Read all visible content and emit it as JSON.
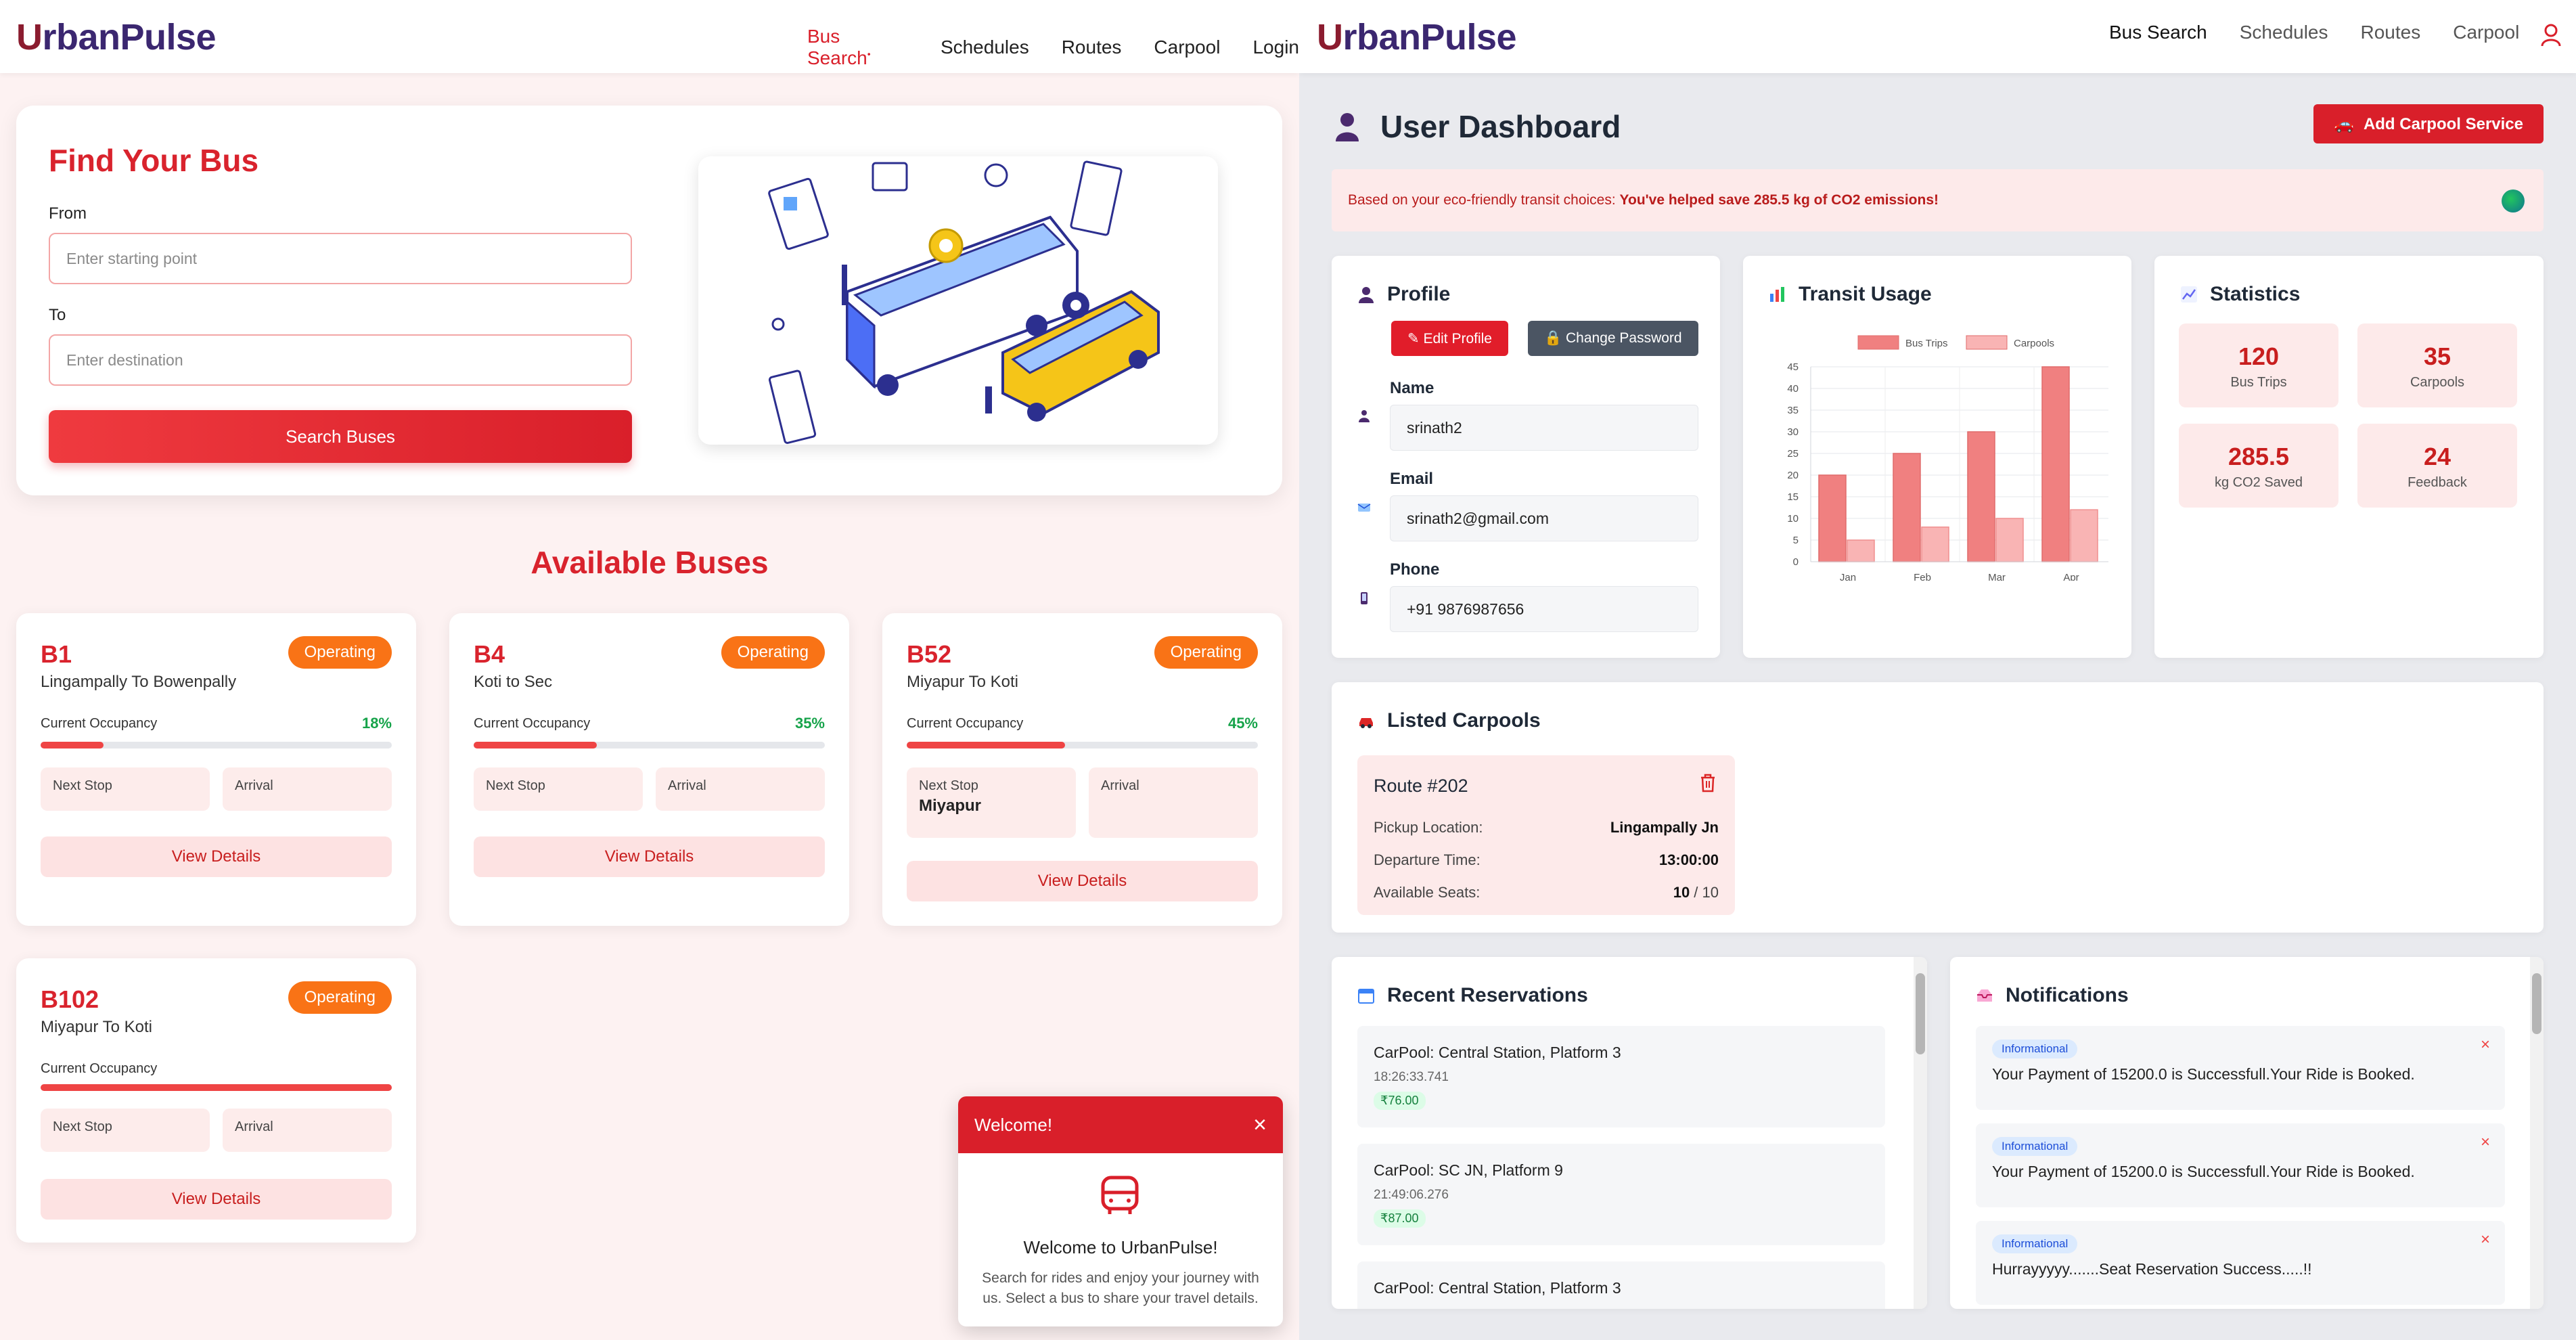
{
  "left": {
    "nav": {
      "logo_u": "U",
      "logo_rest": "rbanPulse",
      "links": [
        "Bus Search",
        "Schedules",
        "Routes",
        "Carpool",
        "Login"
      ]
    },
    "hero": {
      "title": "Find Your Bus",
      "from_label": "From",
      "from_placeholder": "Enter starting point",
      "to_label": "To",
      "to_placeholder": "Enter destination",
      "search_button": "Search Buses"
    },
    "available_title": "Available Buses",
    "buses": [
      {
        "number": "B1",
        "route": "Lingampally To Bowenpally",
        "status": "Operating",
        "occupancy_label": "Current Occupancy",
        "occupancy": "18%",
        "occupancy_fraction": 0.18,
        "next_stop_label": "Next Stop",
        "next_stop": "",
        "arrival_label": "Arrival",
        "button": "View Details"
      },
      {
        "number": "B4",
        "route": "Koti to Sec",
        "status": "Operating",
        "occupancy_label": "Current Occupancy",
        "occupancy": "35%",
        "occupancy_fraction": 0.35,
        "next_stop_label": "Next Stop",
        "next_stop": "",
        "arrival_label": "Arrival",
        "button": "View Details"
      },
      {
        "number": "B52",
        "route": "Miyapur To Koti",
        "status": "Operating",
        "occupancy_label": "Current Occupancy",
        "occupancy": "45%",
        "occupancy_fraction": 0.45,
        "next_stop_label": "Next Stop",
        "next_stop": "Miyapur",
        "arrival_label": "Arrival",
        "button": "View Details"
      },
      {
        "number": "B102",
        "route": "Miyapur To Koti",
        "status": "Operating",
        "occupancy_label": "Current Occupancy",
        "occupancy": "",
        "occupancy_fraction": 1.0,
        "next_stop_label": "Next Stop",
        "next_stop": "",
        "arrival_label": "Arrival",
        "button": "View Details"
      }
    ],
    "toast": {
      "header": "Welcome!",
      "close": "×",
      "title": "Welcome to UrbanPulse!",
      "body": "Search for rides and enjoy your journey with us. Select a bus to share your travel details."
    }
  },
  "right": {
    "nav": {
      "logo_u": "U",
      "logo_rest": "rbanPulse",
      "links": [
        "Bus Search",
        "Schedules",
        "Routes",
        "Carpool"
      ]
    },
    "title": "User Dashboard",
    "add_button": "Add Carpool Service",
    "eco_prefix": "Based on your eco-friendly transit choices:",
    "eco_bold": "You've helped save 285.5 kg of CO2 emissions!",
    "profile": {
      "title": "Profile",
      "edit_button": "Edit Profile",
      "password_button": "Change Password",
      "name_label": "Name",
      "name": "srinath2",
      "email_label": "Email",
      "email": "srinath2@gmail.com",
      "phone_label": "Phone",
      "phone": "+91 9876987656"
    },
    "transit": {
      "title": "Transit Usage"
    },
    "statistics": {
      "title": "Statistics",
      "items": [
        {
          "value": "120",
          "label": "Bus Trips"
        },
        {
          "value": "35",
          "label": "Carpools"
        },
        {
          "value": "285.5",
          "label": "kg CO2 Saved"
        },
        {
          "value": "24",
          "label": "Feedback"
        }
      ]
    },
    "carpools": {
      "title": "Listed Carpools",
      "route": "Route #202",
      "pickup_label": "Pickup Location:",
      "pickup": "Lingampally Jn",
      "departure_label": "Departure Time:",
      "departure": "13:00:00",
      "seats_label": "Available Seats:",
      "seats_avail": "10",
      "seats_total": " / 10"
    },
    "reservations": {
      "title": "Recent Reservations",
      "items": [
        {
          "title": "CarPool: Central Station, Platform 3",
          "time": "18:26:33.741",
          "price": "₹76.00"
        },
        {
          "title": "CarPool: SC JN, Platform 9",
          "time": "21:49:06.276",
          "price": "₹87.00"
        },
        {
          "title": "CarPool: Central Station, Platform 3",
          "time": "",
          "price": ""
        }
      ]
    },
    "notifications": {
      "title": "Notifications",
      "items": [
        {
          "badge": "Informational",
          "message": "Your Payment of 15200.0 is Successfull.Your Ride is Booked."
        },
        {
          "badge": "Informational",
          "message": "Your Payment of 15200.0 is Successfull.Your Ride is Booked."
        },
        {
          "badge": "Informational",
          "message": "Hurrayyyyy.......Seat Reservation Success.....!!"
        }
      ]
    }
  },
  "chart_data": {
    "type": "bar",
    "categories": [
      "Jan",
      "Feb",
      "Mar",
      "Apr"
    ],
    "series": [
      {
        "name": "Bus Trips",
        "values": [
          20,
          25,
          30,
          45
        ],
        "color": "#f08080"
      },
      {
        "name": "Carpools",
        "values": [
          5,
          8,
          10,
          12
        ],
        "color": "#f9b4b4"
      }
    ],
    "ylim": [
      0,
      45
    ],
    "yticks": [
      0,
      5,
      10,
      15,
      20,
      25,
      30,
      35,
      40,
      45
    ],
    "legend": "top",
    "grid": true
  },
  "colors": {
    "brand_red": "#d91f2a",
    "operating_orange": "#f97316",
    "occupancy_green": "#16a34a"
  }
}
